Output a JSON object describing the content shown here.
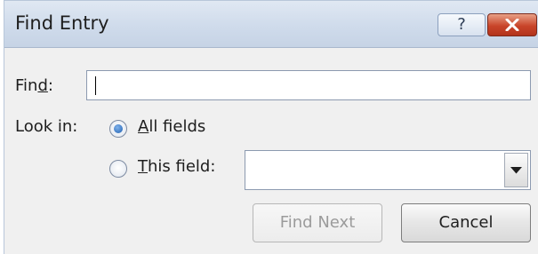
{
  "dialog": {
    "title": "Find Entry",
    "help_glyph": "?",
    "close_icon": "close-x-icon"
  },
  "find": {
    "label_pre": "Fin",
    "label_accel": "d",
    "label_post": ":",
    "value": ""
  },
  "look_in": {
    "label": "Look in:",
    "options": [
      {
        "accel": "A",
        "rest": "ll fields",
        "selected": true
      },
      {
        "accel": "T",
        "rest": "his field:",
        "selected": false
      }
    ],
    "field_value": ""
  },
  "buttons": {
    "find_next": "Find Next",
    "cancel": "Cancel"
  },
  "colors": {
    "close_button": "#c9452a",
    "titlebar": "#cfdbeb",
    "radio_dot": "#1f5fb0"
  }
}
